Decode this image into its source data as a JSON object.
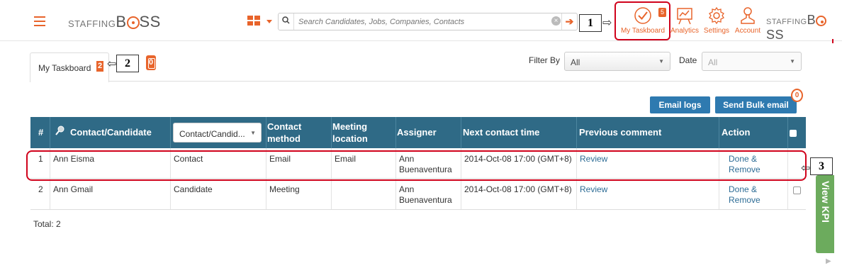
{
  "header": {
    "logo_text_a": "STAFFING",
    "logo_text_b": "B",
    "logo_text_c": "SS",
    "search": {
      "placeholder": "Search Candidates, Jobs, Companies, Contacts"
    },
    "nav": [
      {
        "label": "My Taskboard",
        "icon": "check-circle-icon",
        "badge": "5"
      },
      {
        "label": "Analytics",
        "icon": "chart-board-icon"
      },
      {
        "label": "Settings",
        "icon": "gear-icon"
      },
      {
        "label": "Account",
        "icon": "user-icon"
      }
    ],
    "accent_color": "#e8642b"
  },
  "callouts": {
    "c1": "1",
    "c2": "2",
    "c3": "3"
  },
  "tabs": {
    "active_label": "My Taskboard",
    "active_badge": "2",
    "other_badge": "0"
  },
  "filters": {
    "filter_by_label": "Filter By",
    "filter_by_value": "All",
    "date_label": "Date",
    "date_value": "All"
  },
  "actions": {
    "email_logs": "Email logs",
    "send_bulk": "Send Bulk email",
    "bulk_badge": "0"
  },
  "table": {
    "headers": {
      "num": "#",
      "contact": "Contact/Candidate",
      "type_select": "Contact/Candid...",
      "method_line1": "Contact",
      "method_line2": "method",
      "location_line1": "Meeting",
      "location_line2": "location",
      "assigner": "Assigner",
      "next_time": "Next contact time",
      "prev_comment": "Previous comment",
      "action": "Action"
    },
    "rows": [
      {
        "num": "1",
        "name": "Ann Eisma",
        "type": "Contact",
        "method": "Email",
        "location": "Email",
        "assigner_1": "Ann",
        "assigner_2": "Buenaventura",
        "time": "2014-Oct-08 17:00 (GMT+8)",
        "comment": "Review",
        "action": "Done & Remove"
      },
      {
        "num": "2",
        "name": "Ann Gmail",
        "type": "Candidate",
        "method": "Meeting",
        "location": "",
        "assigner_1": "Ann",
        "assigner_2": "Buenaventura",
        "time": "2014-Oct-08 17:00 (GMT+8)",
        "comment": "Review",
        "action": "Done & Remove"
      }
    ],
    "total": "Total: 2"
  },
  "kpi": {
    "label": "View KPI"
  }
}
